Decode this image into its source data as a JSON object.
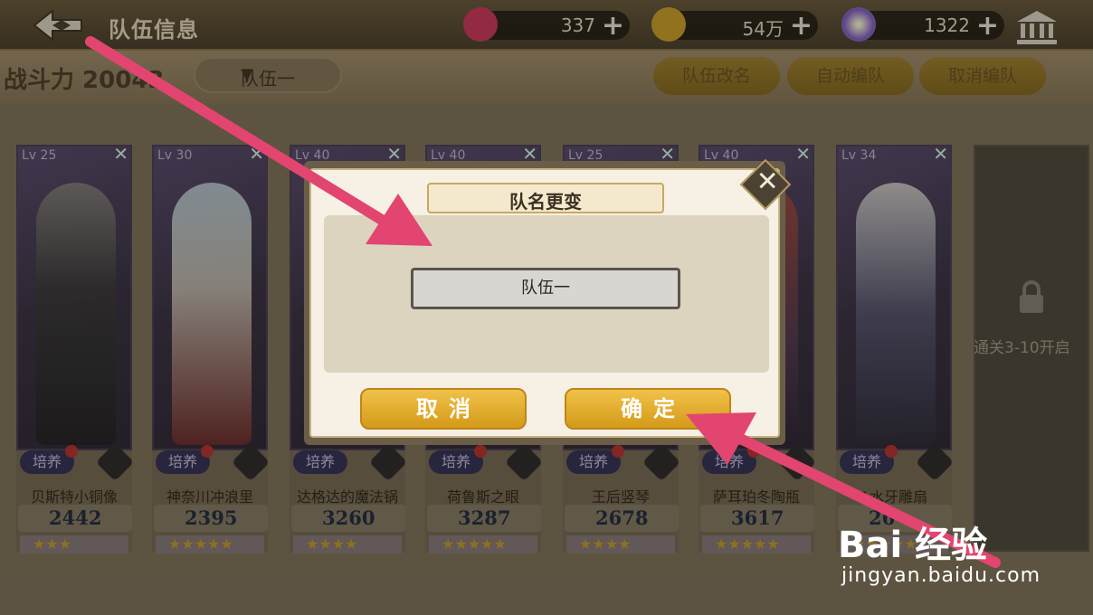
{
  "header": {
    "title": "队伍信息",
    "resources": [
      {
        "name": "stamina",
        "amount": "337",
        "color": "#d63a5e"
      },
      {
        "name": "gold",
        "amount": "54万",
        "color": "#d4a62a"
      },
      {
        "name": "gem",
        "amount": "1322",
        "color": "#8a5fd1"
      }
    ],
    "plus": "+"
  },
  "subheader": {
    "power_label": "战斗力 20043",
    "team_selected": "队伍一",
    "rename_btn": "队伍改名",
    "auto_btn": "自动编队",
    "cancel_formation_btn": "取消编队"
  },
  "cards": [
    {
      "level": "Lv 25",
      "name": "贝斯特小铜像",
      "power": "2442",
      "stars": "★★★"
    },
    {
      "level": "Lv 30",
      "name": "神奈川冲浪里",
      "power": "2395",
      "stars": "★★★★★"
    },
    {
      "level": "Lv 40",
      "name": "达格达的魔法锅",
      "power": "3260",
      "stars": "★★★★"
    },
    {
      "level": "Lv 40",
      "name": "荷鲁斯之眼",
      "power": "3287",
      "stars": "★★★★★"
    },
    {
      "level": "Lv 25",
      "name": "王后竖琴",
      "power": "2678",
      "stars": "★★★★"
    },
    {
      "level": "Lv 40",
      "name": "萨耳珀冬陶瓶",
      "power": "3617",
      "stars": "★★★★★"
    },
    {
      "level": "Lv 34",
      "name": "1水牙雕扇",
      "power": "26",
      "stars": "★★★★★"
    }
  ],
  "card_common": {
    "train": "培养",
    "close": "✕"
  },
  "locked_slot": {
    "text": "通关3-10开启"
  },
  "dialog": {
    "title": "队名更变",
    "input_value": "队伍一",
    "cancel": "取消",
    "confirm": "确定",
    "close": "✕"
  },
  "watermark": {
    "logo": "Bai 经验",
    "url": "jingyan.baidu.com"
  },
  "colors": {
    "accent": "#e2456f",
    "button_gold": "#e0a82a"
  }
}
